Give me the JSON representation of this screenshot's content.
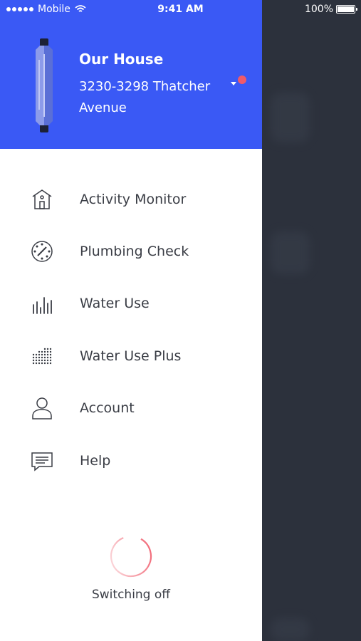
{
  "status_bar": {
    "carrier": "Mobile",
    "time": "9:41 AM",
    "battery": "100%"
  },
  "header": {
    "title": "Our House",
    "address": "3230-3298 Thatcher Avenue",
    "colors": {
      "background": "#3a59f5",
      "alert_dot": "#f05a6a"
    }
  },
  "menu": {
    "items": [
      {
        "label": "Activity Monitor",
        "icon": "house-icon"
      },
      {
        "label": "Plumbing Check",
        "icon": "gauge-icon"
      },
      {
        "label": "Water Use",
        "icon": "bars-icon"
      },
      {
        "label": "Water Use Plus",
        "icon": "dot-grid-icon"
      },
      {
        "label": "Account",
        "icon": "person-icon"
      },
      {
        "label": "Help",
        "icon": "chat-icon"
      }
    ]
  },
  "footer": {
    "status": "Switching off",
    "spinner_color": "#f05a6a"
  }
}
